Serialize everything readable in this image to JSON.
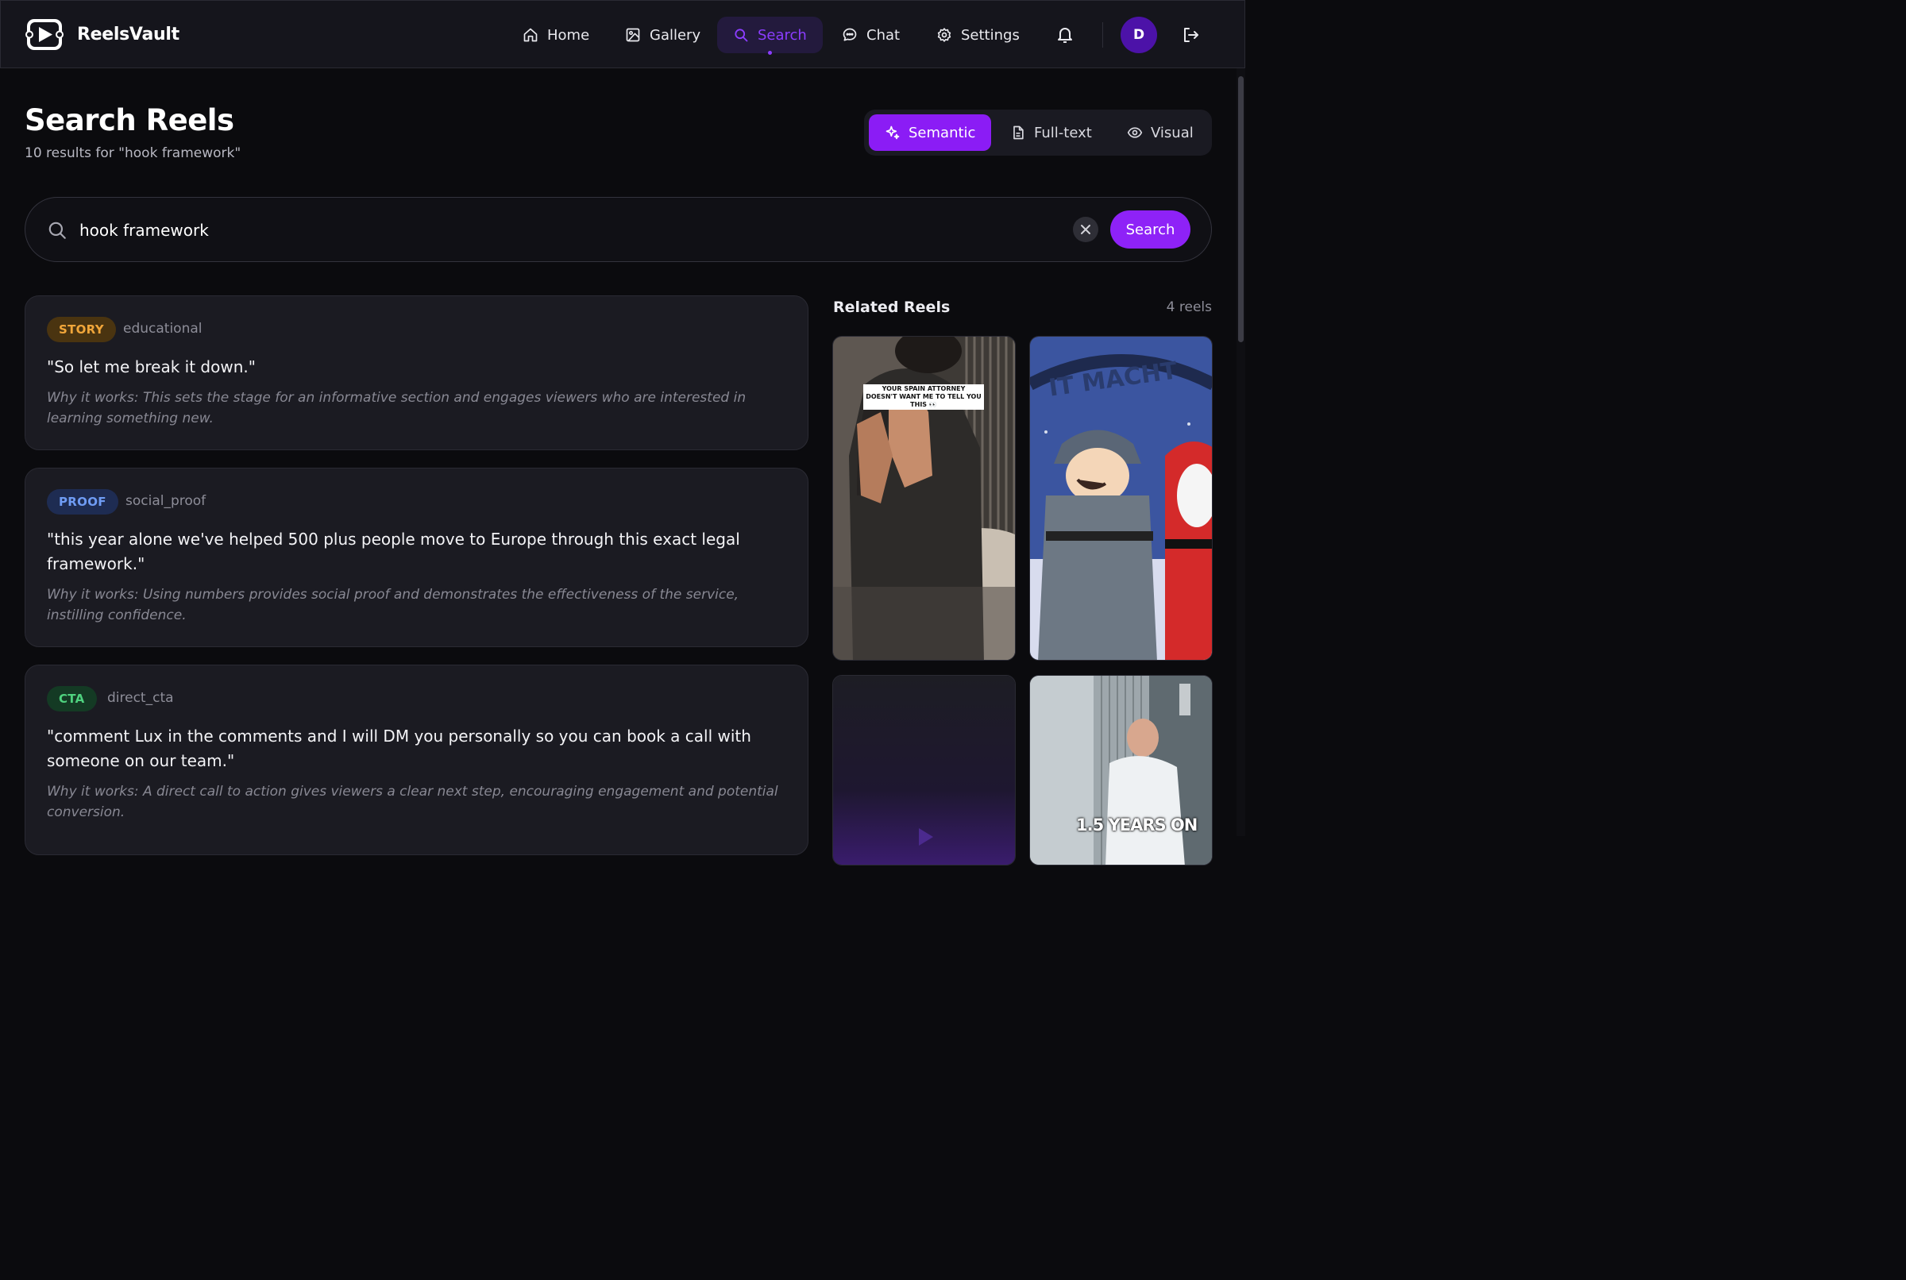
{
  "app": {
    "name": "ReelsVault"
  },
  "nav": {
    "items": [
      {
        "label": "Home",
        "icon": "home-icon"
      },
      {
        "label": "Gallery",
        "icon": "image-icon"
      },
      {
        "label": "Search",
        "icon": "search-icon",
        "active": true
      },
      {
        "label": "Chat",
        "icon": "chat-bubble-icon"
      },
      {
        "label": "Settings",
        "icon": "gear-icon"
      }
    ],
    "notifications_icon": "bell-icon",
    "avatar_initial": "D",
    "logout_icon": "logout-icon"
  },
  "header": {
    "title": "Search Reels",
    "subtitle": "10 results for \"hook framework\""
  },
  "search_modes": [
    {
      "label": "Semantic",
      "icon": "sparkle-icon",
      "active": true
    },
    {
      "label": "Full-text",
      "icon": "document-icon",
      "active": false
    },
    {
      "label": "Visual",
      "icon": "eye-icon",
      "active": false
    }
  ],
  "search": {
    "query": "hook framework",
    "button_label": "Search"
  },
  "results": [
    {
      "tag": "STORY",
      "category": "educational",
      "quote": "\"So let me break it down.\"",
      "why": "Why it works: This sets the stage for an informative section and engages viewers who are interested in learning something new."
    },
    {
      "tag": "PROOF",
      "category": "social_proof",
      "quote": "\"this year alone we've helped 500 plus people move to Europe through this exact legal framework.\"",
      "why": "Why it works: Using numbers provides social proof and demonstrates the effectiveness of the service, instilling confidence."
    },
    {
      "tag": "CTA",
      "category": "direct_cta",
      "quote": "\"comment Lux in the comments and I will DM you personally so you can book a call with someone on our team.\"",
      "why": "Why it works: A direct call to action gives viewers a clear next step, encouraging engagement and potential conversion."
    }
  ],
  "related": {
    "title": "Related Reels",
    "count": "4 reels",
    "thumbs": [
      {
        "caption": "YOUR SPAIN ATTORNEY DOESN'T WANT ME TO TELL YOU THIS 👀"
      },
      {
        "caption": ""
      },
      {
        "caption": ""
      },
      {
        "caption": "1.5 YEARS ON"
      }
    ]
  },
  "colors": {
    "accent": "#8b1cf5",
    "background": "#0b0b0e",
    "card": "#1b1b22",
    "story_badge": "#f1a63a",
    "proof_badge": "#6f9cf4",
    "cta_badge": "#4fd27f"
  }
}
